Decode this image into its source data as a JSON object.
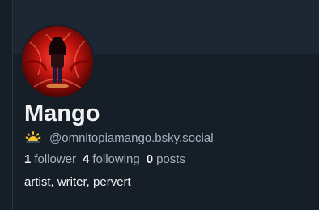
{
  "profile": {
    "display_name": "Mango",
    "handle": "@omnitopiamango.bsky.social",
    "handle_emoji": "sunrise-emoji-icon",
    "bio": "artist, writer, pervert",
    "avatar": "avatar-image"
  },
  "stats": {
    "followers_count": "1",
    "followers_label": "follower",
    "following_count": "4",
    "following_label": "following",
    "posts_count": "0",
    "posts_label": "posts"
  },
  "colors": {
    "background": "#161e27",
    "banner": "#1d2733",
    "text_primary": "#f1f3f5",
    "text_secondary": "#a6b3c2"
  }
}
